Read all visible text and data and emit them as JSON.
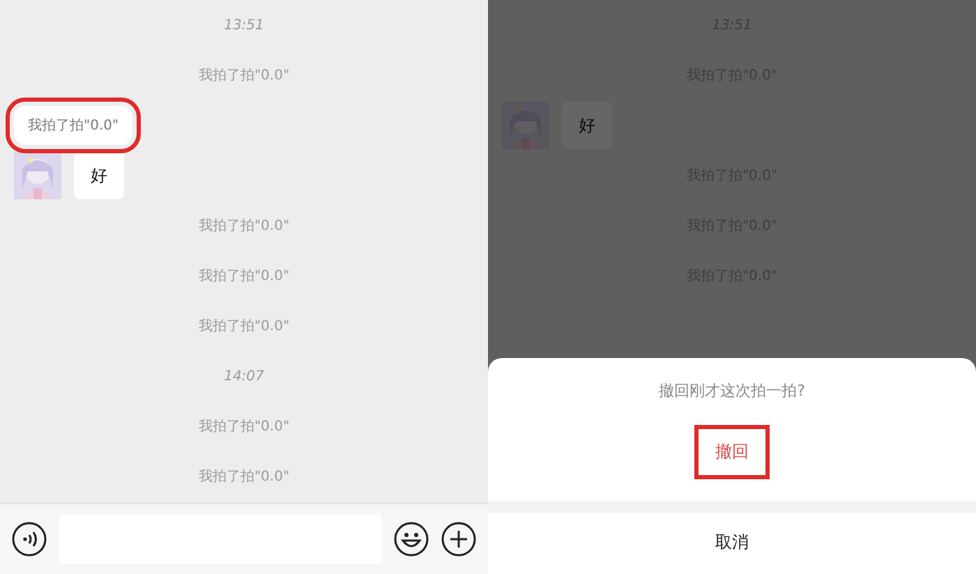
{
  "left": {
    "messages": [
      {
        "kind": "time",
        "text": "13:51"
      },
      {
        "kind": "notice",
        "text": "我拍了拍\"0.0\""
      },
      {
        "kind": "tip",
        "text": "我拍了拍\"0.0\"",
        "highlighted": true
      },
      {
        "kind": "message",
        "text": "好"
      },
      {
        "kind": "notice",
        "text": "我拍了拍\"0.0\""
      },
      {
        "kind": "notice",
        "text": "我拍了拍\"0.0\""
      },
      {
        "kind": "notice",
        "text": "我拍了拍\"0.0\""
      },
      {
        "kind": "time",
        "text": "14:07"
      },
      {
        "kind": "notice",
        "text": "我拍了拍\"0.0\""
      },
      {
        "kind": "notice",
        "text": "我拍了拍\"0.0\""
      }
    ]
  },
  "right": {
    "messages": [
      {
        "kind": "time",
        "text": "13:51"
      },
      {
        "kind": "notice",
        "text": "我拍了拍\"0.0\""
      },
      {
        "kind": "message",
        "text": "好"
      },
      {
        "kind": "notice",
        "text": "我拍了拍\"0.0\""
      },
      {
        "kind": "notice",
        "text": "我拍了拍\"0.0\""
      },
      {
        "kind": "notice",
        "text": "我拍了拍\"0.0\""
      }
    ],
    "sheet": {
      "title": "撤回刚才这次拍一拍?",
      "actions": [
        {
          "kind": "destructive",
          "label": "撤回",
          "highlighted": true
        },
        {
          "kind": "cancel",
          "label": "取消",
          "highlighted": false
        }
      ]
    }
  }
}
